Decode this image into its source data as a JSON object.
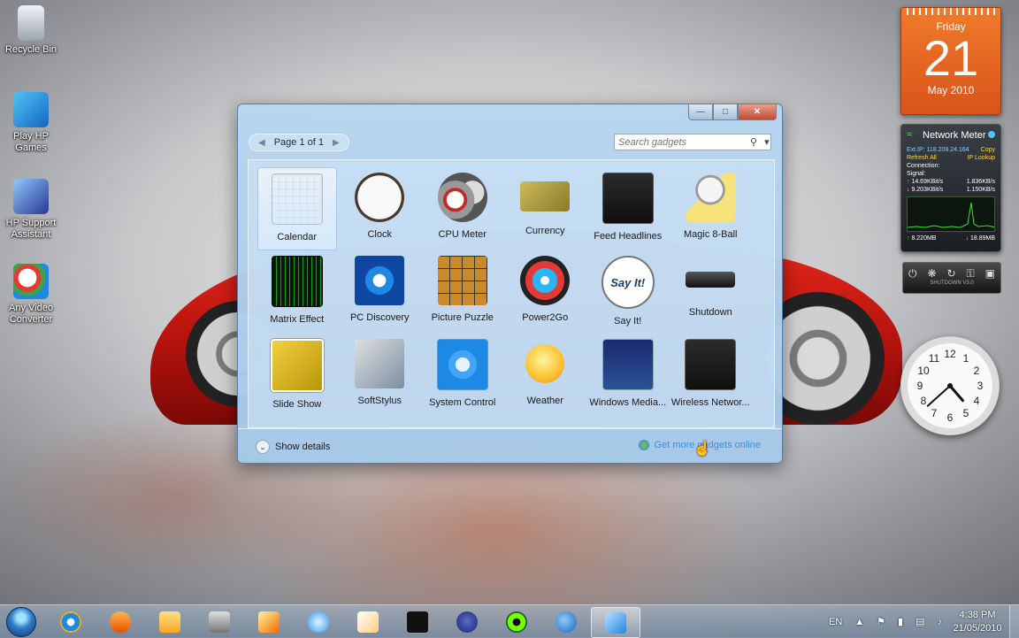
{
  "desktop": {
    "icons": [
      {
        "label": "Recycle Bin"
      },
      {
        "label": "Play HP Games"
      },
      {
        "label": "HP Support Assistant"
      },
      {
        "label": "Any Video Converter"
      }
    ]
  },
  "gadgets": {
    "calendar": {
      "day": "Friday",
      "date": "21",
      "month": "May 2010"
    },
    "network_meter": {
      "title": "Network Meter",
      "ext_ip": "Ext.IP: 118.208.24.164",
      "copy": "Copy",
      "refresh": "Refresh All",
      "ip_lookup": "IP Lookup",
      "connection": "Connection:",
      "signal": "Signal:",
      "up_rate_1": "14.69KBit/s",
      "up_rate_2": "1.836KB/s",
      "down_rate_1": "9.203KBit/s",
      "down_rate_2": "1.150KB/s",
      "total_up": "8.220MB",
      "total_down": "18.89MB"
    },
    "shutdown": {
      "label": "SHUTDOWN V3.0"
    },
    "clock": {
      "hour": 4,
      "minute": 38
    }
  },
  "window": {
    "pager": {
      "label": "Page 1 of 1"
    },
    "search": {
      "placeholder": "Search gadgets"
    },
    "items": [
      {
        "name": "Calendar",
        "icon": "calendar-icon"
      },
      {
        "name": "Clock",
        "icon": "clock-icon"
      },
      {
        "name": "CPU Meter",
        "icon": "cpu-meter-icon"
      },
      {
        "name": "Currency",
        "icon": "currency-icon"
      },
      {
        "name": "Feed Headlines",
        "icon": "feed-headlines-icon"
      },
      {
        "name": "Magic 8-Ball",
        "icon": "magic-8-ball-icon"
      },
      {
        "name": "Matrix Effect",
        "icon": "matrix-effect-icon"
      },
      {
        "name": "PC Discovery",
        "icon": "pc-discovery-icon"
      },
      {
        "name": "Picture Puzzle",
        "icon": "picture-puzzle-icon"
      },
      {
        "name": "Power2Go",
        "icon": "power2go-icon"
      },
      {
        "name": "Say It!",
        "icon": "say-it-icon"
      },
      {
        "name": "Shutdown",
        "icon": "shutdown-icon"
      },
      {
        "name": "Slide Show",
        "icon": "slide-show-icon"
      },
      {
        "name": "SoftStylus",
        "icon": "softstylus-icon"
      },
      {
        "name": "System Control",
        "icon": "system-control-icon"
      },
      {
        "name": "Weather",
        "icon": "weather-icon"
      },
      {
        "name": "Windows Media...",
        "icon": "windows-media-icon"
      },
      {
        "name": "Wireless Networ...",
        "icon": "wireless-network-icon"
      }
    ],
    "say_it_text": "Say It!",
    "footer": {
      "details": "Show details",
      "online": "Get more gadgets online"
    }
  },
  "taskbar": {
    "language": "EN",
    "time": "4:38 PM",
    "date": "21/05/2010"
  },
  "colors": {
    "calendar_orange": "#e86422",
    "window_blue": "#b8d6f0",
    "car_red": "#d21f17"
  }
}
